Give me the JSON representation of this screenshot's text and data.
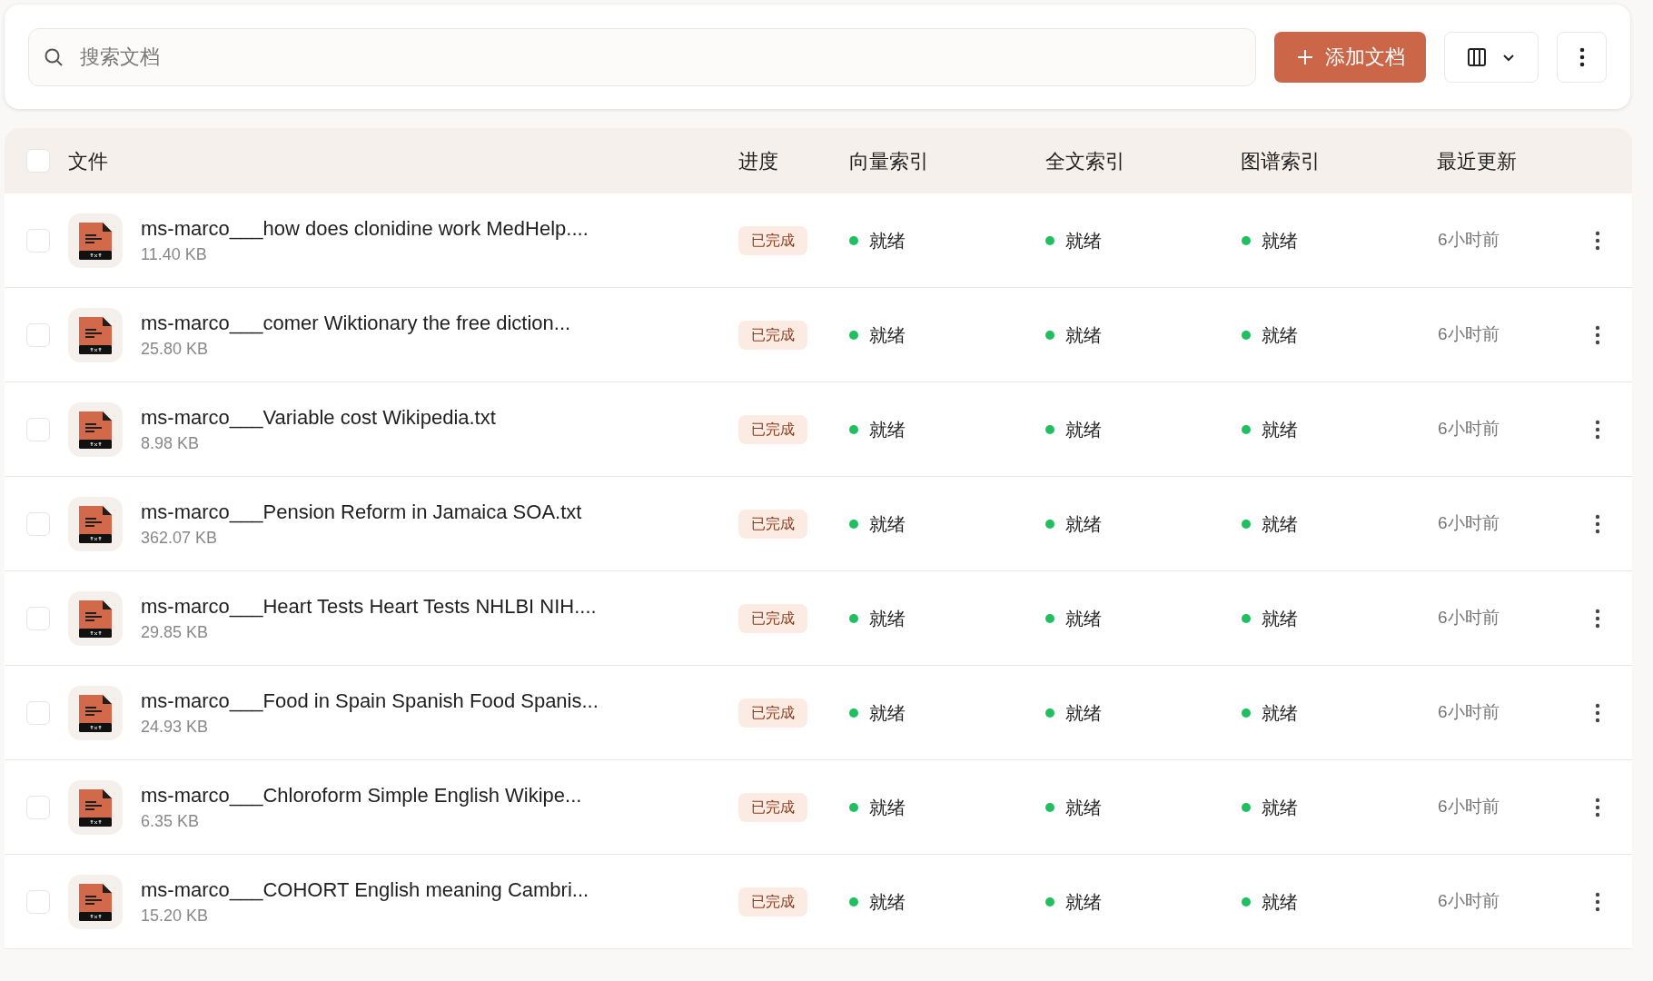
{
  "toolbar": {
    "search": {
      "placeholder": "搜索文档"
    },
    "add_button": "添加文档"
  },
  "table": {
    "columns": [
      "文件",
      "进度",
      "向量索引",
      "全文索引",
      "图谱索引",
      "最近更新"
    ],
    "select_all": {
      "checked": false
    },
    "rows": [
      {
        "checked": false,
        "name": "ms-marco___how does clonidine work MedHelp....",
        "size": "11.40 KB",
        "progress": "已完成",
        "vector": "就绪",
        "fulltext": "就绪",
        "graph": "就绪",
        "updated": "6小时前"
      },
      {
        "checked": false,
        "name": "ms-marco___comer Wiktionary the free diction...",
        "size": "25.80 KB",
        "progress": "已完成",
        "vector": "就绪",
        "fulltext": "就绪",
        "graph": "就绪",
        "updated": "6小时前"
      },
      {
        "checked": false,
        "name": "ms-marco___Variable cost Wikipedia.txt",
        "size": "8.98 KB",
        "progress": "已完成",
        "vector": "就绪",
        "fulltext": "就绪",
        "graph": "就绪",
        "updated": "6小时前"
      },
      {
        "checked": false,
        "name": "ms-marco___Pension Reform in Jamaica SOA.txt",
        "size": "362.07 KB",
        "progress": "已完成",
        "vector": "就绪",
        "fulltext": "就绪",
        "graph": "就绪",
        "updated": "6小时前"
      },
      {
        "checked": false,
        "name": "ms-marco___Heart Tests Heart Tests NHLBI NIH....",
        "size": "29.85 KB",
        "progress": "已完成",
        "vector": "就绪",
        "fulltext": "就绪",
        "graph": "就绪",
        "updated": "6小时前"
      },
      {
        "checked": false,
        "name": "ms-marco___Food in Spain Spanish Food Spanis...",
        "size": "24.93 KB",
        "progress": "已完成",
        "vector": "就绪",
        "fulltext": "就绪",
        "graph": "就绪",
        "updated": "6小时前"
      },
      {
        "checked": false,
        "name": "ms-marco___Chloroform Simple English Wikipe...",
        "size": "6.35 KB",
        "progress": "已完成",
        "vector": "就绪",
        "fulltext": "就绪",
        "graph": "就绪",
        "updated": "6小时前"
      },
      {
        "checked": false,
        "name": "ms-marco___COHORT English meaning Cambri...",
        "size": "15.20 KB",
        "progress": "已完成",
        "vector": "就绪",
        "fulltext": "就绪",
        "graph": "就绪",
        "updated": "6小时前"
      }
    ]
  }
}
